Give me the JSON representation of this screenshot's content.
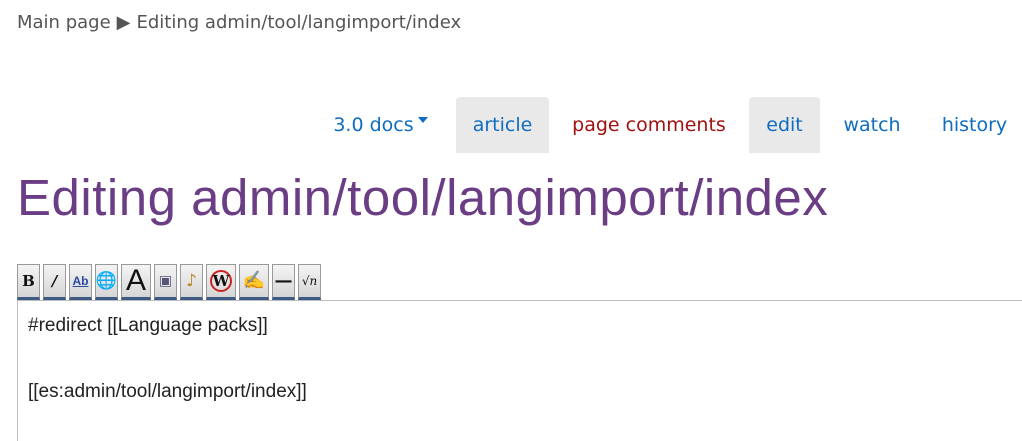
{
  "breadcrumb": {
    "home": "Main page",
    "separator": "▶",
    "current": "Editing admin/tool/langimport/index"
  },
  "tabs": [
    {
      "label": "3.0 docs",
      "has_dropdown": true
    },
    {
      "label": "article",
      "active": true
    },
    {
      "label": "page comments",
      "color": "#a11111"
    },
    {
      "label": "edit",
      "active": true
    },
    {
      "label": "watch"
    },
    {
      "label": "history"
    }
  ],
  "page": {
    "title": "Editing admin/tool/langimport/index"
  },
  "toolbar": {
    "buttons": [
      {
        "name": "bold-icon",
        "glyph": "B"
      },
      {
        "name": "italic-icon",
        "glyph": "/"
      },
      {
        "name": "internal-link-icon",
        "glyph": "Ab"
      },
      {
        "name": "external-link-icon",
        "glyph": "🌐"
      },
      {
        "name": "headline-icon",
        "glyph": "A"
      },
      {
        "name": "embedded-file-icon",
        "glyph": "▣"
      },
      {
        "name": "media-file-icon",
        "glyph": "♪"
      },
      {
        "name": "no-wiki-icon",
        "glyph": "W"
      },
      {
        "name": "signature-icon",
        "glyph": "✍"
      },
      {
        "name": "horizontal-line-icon",
        "glyph": "—"
      },
      {
        "name": "math-formula-icon",
        "glyph": "√n"
      }
    ]
  },
  "editor": {
    "lines": [
      "#redirect [[Language packs]]",
      "",
      "[[es:admin/tool/langimport/index]]"
    ]
  },
  "colors": {
    "link": "#0f6cbf",
    "title": "#6b3d85",
    "warning_link": "#a11111",
    "tab_bg": "#e9e9e9"
  }
}
